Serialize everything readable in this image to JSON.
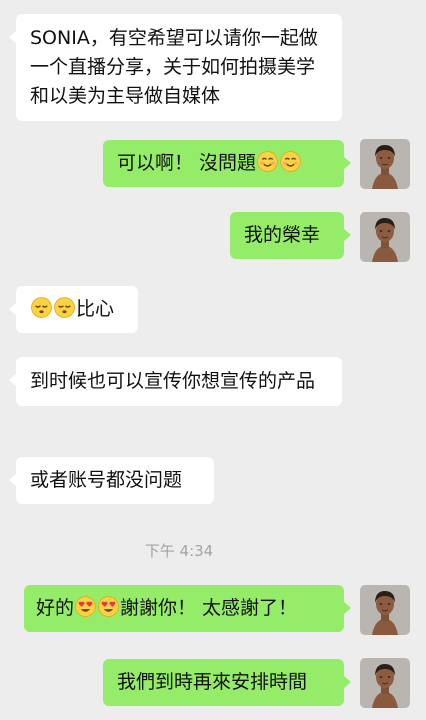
{
  "messages": [
    {
      "side": "in",
      "parts": [
        {
          "text": "SONIA，有空希望可以请你一起做一个直播分享，关于如何拍摄美学和以美为主导做自媒体"
        }
      ]
    },
    {
      "side": "out",
      "parts": [
        {
          "text": "可以啊！ 沒問題"
        },
        {
          "emoji": "smiling-face-icon"
        },
        {
          "emoji": "smiling-face-icon"
        }
      ]
    },
    {
      "side": "out",
      "parts": [
        {
          "text": "我的榮幸"
        }
      ]
    },
    {
      "side": "in",
      "parts": [
        {
          "emoji": "sleepy-face-icon"
        },
        {
          "emoji": "sleepy-face-icon"
        },
        {
          "text": "比心"
        }
      ]
    },
    {
      "side": "in",
      "parts": [
        {
          "text": "到时候也可以宣传你想宣传的产品"
        }
      ]
    },
    {
      "side": "in",
      "parts": [
        {
          "text": "或者账号都没问题"
        }
      ]
    },
    {
      "side": "out",
      "parts": [
        {
          "text": "好的"
        },
        {
          "emoji": "heart-eyes-icon"
        },
        {
          "emoji": "heart-eyes-icon"
        },
        {
          "text": "謝謝你！ 太感謝了！"
        }
      ]
    },
    {
      "side": "out",
      "parts": [
        {
          "text": "我們到時再來安排時間"
        }
      ]
    }
  ],
  "timestamp": "下午 4:34",
  "colors": {
    "background": "#ededed",
    "incoming_bubble": "#ffffff",
    "outgoing_bubble": "#95ec69",
    "timestamp_text": "#a3a3a3"
  }
}
